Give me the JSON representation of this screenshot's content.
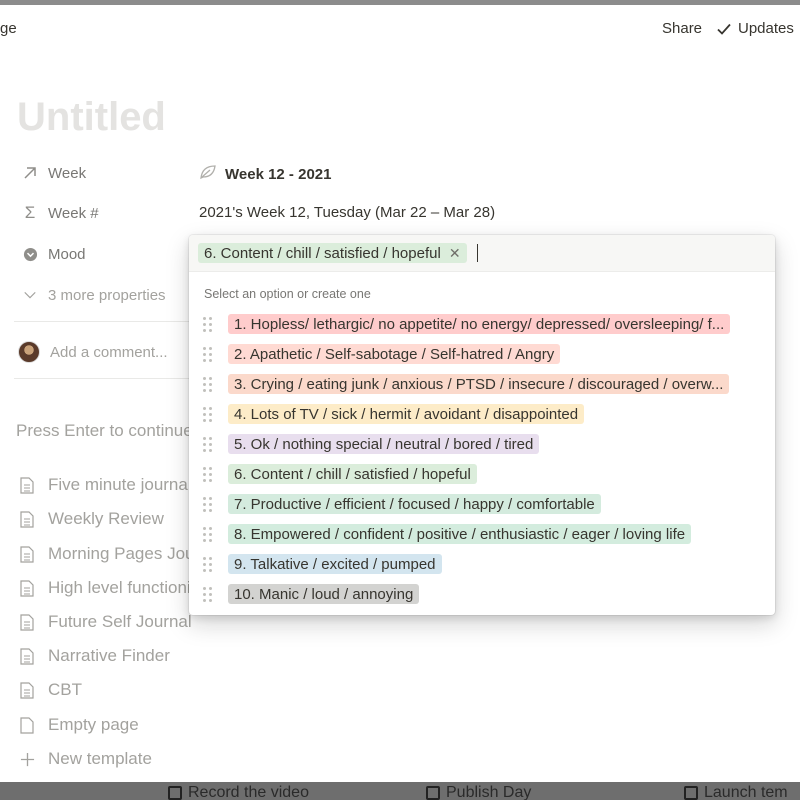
{
  "header": {
    "crumb": "ge",
    "share_label": "Share",
    "updates_label": "Updates"
  },
  "page": {
    "title_placeholder": "Untitled"
  },
  "properties": [
    {
      "label": "Week",
      "icon": "arrow-up-right-icon",
      "value": "Week 12 - 2021",
      "value_icon": "leaf-icon"
    },
    {
      "label": "Week #",
      "icon": "sigma-icon",
      "value": "2021's Week 12, Tuesday (Mar 22 – Mar 28)"
    },
    {
      "label": "Mood",
      "icon": "chevron-circle-icon"
    },
    {
      "label": "3 more properties",
      "icon": "chevron-down-icon"
    }
  ],
  "comment": {
    "placeholder": "Add a comment..."
  },
  "press_enter": "Press Enter to continue",
  "templates": [
    {
      "label": "Five minute journal",
      "icon": "page-icon"
    },
    {
      "label": "Weekly Review",
      "icon": "page-icon"
    },
    {
      "label": "Morning Pages Journal",
      "icon": "page-icon"
    },
    {
      "label": "High level functioning",
      "icon": "page-icon"
    },
    {
      "label": "Future Self Journal",
      "icon": "page-icon"
    },
    {
      "label": "Narrative Finder",
      "icon": "page-icon"
    },
    {
      "label": "CBT",
      "icon": "page-icon"
    },
    {
      "label": "Empty page",
      "icon": "empty-page-icon"
    },
    {
      "label": "New template",
      "icon": "plus-icon"
    }
  ],
  "dropdown": {
    "selected": {
      "label": "6. Content / chill / satisfied / hopeful",
      "color": "#dbeddb"
    },
    "hint": "Select an option or create one",
    "options": [
      {
        "label": "1. Hopless/ lethargic/ no appetite/ no energy/ depressed/ oversleeping/ f...",
        "color": "#ffcccc"
      },
      {
        "label": "2. Apathetic / Self-sabotage / Self-hatred / Angry",
        "color": "#ffdad3"
      },
      {
        "label": "3. Crying / eating junk / anxious / PTSD / insecure / discouraged / overw...",
        "color": "#fbd9cb"
      },
      {
        "label": "4. Lots of TV / sick / hermit / avoidant / disappointed",
        "color": "#fdecc8"
      },
      {
        "label": "5. Ok / nothing special / neutral / bored / tired",
        "color": "#e8deee"
      },
      {
        "label": "6. Content / chill / satisfied / hopeful",
        "color": "#dbeddb"
      },
      {
        "label": "7. Productive / efficient / focused / happy / comfortable",
        "color": "#d4ebde"
      },
      {
        "label": "8. Empowered / confident / positive / enthusiastic / eager / loving life",
        "color": "#d3ecde"
      },
      {
        "label": "9. Talkative / excited / pumped",
        "color": "#d3e5ef"
      },
      {
        "label": "10. Manic / loud / annoying",
        "color": "#d3d3d1"
      }
    ]
  },
  "background_bottom": {
    "items": [
      "Record the video",
      "Publish Day",
      "Launch tem"
    ]
  }
}
